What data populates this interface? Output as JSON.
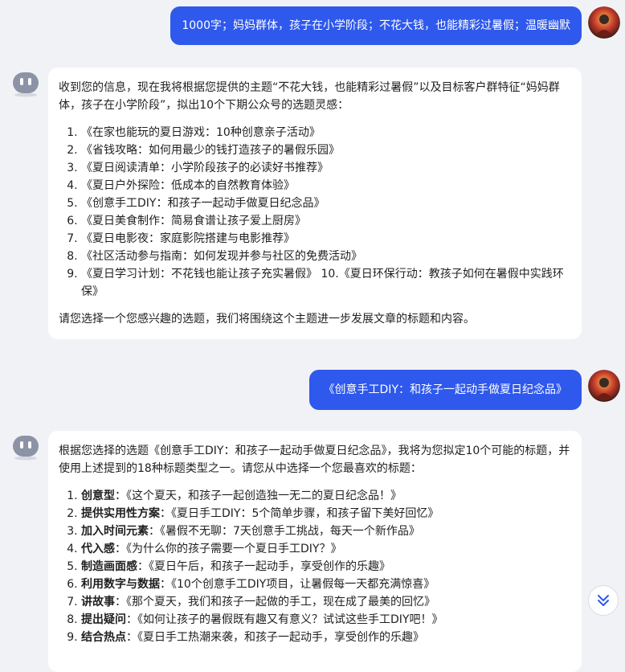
{
  "messages": {
    "user1": "1000字；妈妈群体，孩子在小学阶段；不花大钱，也能精彩过暑假；温暖幽默",
    "bot1": {
      "intro": "收到您的信息，现在我将根据您提供的主题“不花大钱，也能精彩过暑假”以及目标客户群特征“妈妈群体，孩子在小学阶段”，拟出10个下期公众号的选题灵感：",
      "items": [
        "《在家也能玩的夏日游戏：10种创意亲子活动》",
        "《省钱攻略：如何用最少的钱打造孩子的暑假乐园》",
        "《夏日阅读清单：小学阶段孩子的必读好书推荐》",
        "《夏日户外探险：低成本的自然教育体验》",
        "《创意手工DIY：和孩子一起动手做夏日纪念品》",
        "《夏日美食制作：简易食谱让孩子爱上厨房》",
        "《夏日电影夜：家庭影院搭建与电影推荐》",
        "《社区活动参与指南：如何发现并参与社区的免费活动》",
        "《夏日学习计划：不花钱也能让孩子充实暑假》 10.《夏日环保行动：教孩子如何在暑假中实践环保》"
      ],
      "outro": "请您选择一个您感兴趣的选题，我们将围绕这个主题进一步发展文章的标题和内容。"
    },
    "user2": "《创意手工DIY：和孩子一起动手做夏日纪念品》",
    "bot2": {
      "intro": "根据您选择的选题《创意手工DIY：和孩子一起动手做夏日纪念品》，我将为您拟定10个可能的标题，并使用上述提到的18种标题类型之一。请您从中选择一个您最喜欢的标题：",
      "items": [
        {
          "type": "创意型",
          "title": "：《这个夏天，和孩子一起创造独一无二的夏日纪念品！》"
        },
        {
          "type": "提供实用性方案",
          "title": "：《夏日手工DIY：5个简单步骤，和孩子留下美好回忆》"
        },
        {
          "type": "加入时间元素",
          "title": "：《暑假不无聊：7天创意手工挑战，每天一个新作品》"
        },
        {
          "type": "代入感",
          "title": "：《为什么你的孩子需要一个夏日手工DIY？》"
        },
        {
          "type": "制造画面感",
          "title": "：《夏日午后，和孩子一起动手，享受创作的乐趣》"
        },
        {
          "type": "利用数字与数据",
          "title": "：《10个创意手工DIY项目，让暑假每一天都充满惊喜》"
        },
        {
          "type": "讲故事",
          "title": "：《那个夏天，我们和孩子一起做的手工，现在成了最美的回忆》"
        },
        {
          "type": "提出疑问",
          "title": "：《如何让孩子的暑假既有趣又有意义？试试这些手工DIY吧！》"
        },
        {
          "type": "结合热点",
          "title": "：《夏日手工热潮来袭，和孩子一起动手，享受创作的乐趣》"
        }
      ]
    }
  },
  "colors": {
    "user_bubble": "#2f58ec",
    "page_bg": "#f1f2f6"
  },
  "icons": {
    "user_avatar": "user-avatar",
    "bot_avatar": "bot-avatar-icon",
    "scroll_down": "double-chevron-down-icon"
  }
}
